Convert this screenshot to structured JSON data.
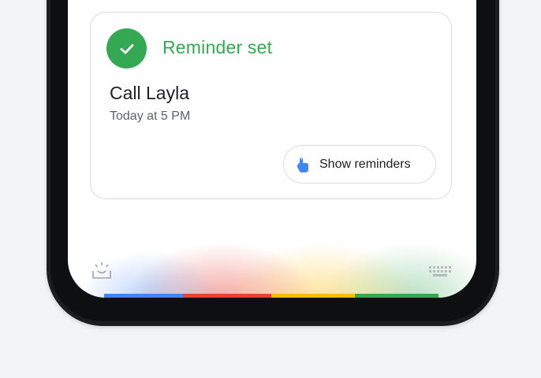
{
  "card": {
    "status": "Reminder set",
    "title": "Call Layla",
    "time": "Today at 5 PM",
    "button_label": "Show reminders"
  },
  "icons": {
    "status": "check-icon",
    "button": "hand-pointer-icon",
    "left_bottom": "lens-icon",
    "right_bottom": "keyboard-icon"
  },
  "colors": {
    "accent_green": "#34a853",
    "blue": "#4285f4",
    "red": "#ea4335",
    "yellow": "#fbbc05"
  }
}
